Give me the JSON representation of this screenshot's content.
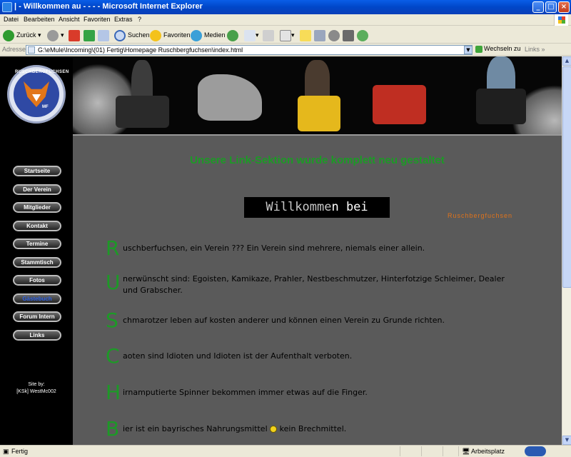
{
  "window": {
    "title": "| - Willkommen au - - - - Microsoft Internet Explorer"
  },
  "menu": [
    "Datei",
    "Bearbeiten",
    "Ansicht",
    "Favoriten",
    "Extras",
    "?"
  ],
  "toolbar": {
    "back": "Zurück",
    "search": "Suchen",
    "favorites": "Favoriten",
    "media": "Medien"
  },
  "addressbar": {
    "label": "Adresse",
    "url": "G:\\eMule\\Incoming\\(01) Fertig\\Homepage Ruschbergfuchsen\\index.html",
    "go": "Wechseln zu",
    "links": "Links"
  },
  "logo": {
    "text": "RUSCHBERGFUCHSEN",
    "initials": "MF"
  },
  "nav": [
    {
      "label": "Startseite"
    },
    {
      "label": "Der Verein"
    },
    {
      "label": "Mitglieder"
    },
    {
      "label": "Kontakt"
    },
    {
      "label": "Termine"
    },
    {
      "label": "Stammtisch"
    },
    {
      "label": "Fotos"
    },
    {
      "label": "Gästebuch",
      "active": true
    },
    {
      "label": "Forum Intern"
    },
    {
      "label": "Links"
    }
  ],
  "credit": {
    "line1": "Site by:",
    "line2": "[KSk] WestMc002"
  },
  "content": {
    "headline": "Unsere Link-Sektion wurde komplett neu gestaltet",
    "welcome_ghost": "Willkomme",
    "welcome_main": "n bei",
    "club": "Ruschbergfuchsen",
    "acrostic": [
      {
        "letter": "R",
        "text": "uschberfuchsen, ein Verein ??? Ein Verein sind mehrere, niemals einer allein."
      },
      {
        "letter": "U",
        "text": "nerwünscht sind: Egoisten, Kamikaze, Prahler, Nestbeschmutzer, Hinterfotzige Schleimer, Dealer und Grabscher."
      },
      {
        "letter": "S",
        "text": "chmarotzer leben auf kosten anderer und können einen Verein zu Grunde richten."
      },
      {
        "letter": "C",
        "text": "aoten sind Idioten und Idioten ist der Aufenthalt verboten."
      },
      {
        "letter": "H",
        "text": "irnamputierte Spinner bekommen immer etwas auf die Finger."
      },
      {
        "letter": "B",
        "text_before": "ier ist ein bayrisches Nahrungsmittel",
        "text_after": "kein Brechmittel."
      }
    ]
  },
  "status": {
    "left": "Fertig",
    "zone": "Arbeitsplatz"
  },
  "colors": {
    "green": "#1c9a26",
    "orange": "#e0731b",
    "page_bg": "#5a5a5a",
    "active_nav": "#2e62e6"
  }
}
